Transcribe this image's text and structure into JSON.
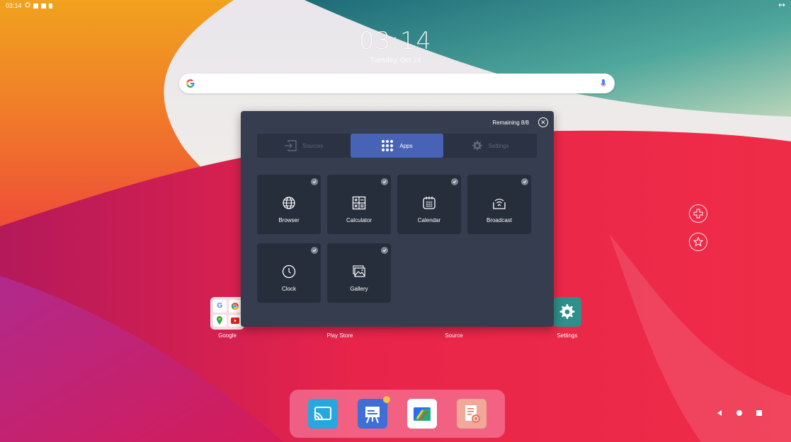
{
  "status_bar": {
    "time": "03:14"
  },
  "home": {
    "clock": "03:14",
    "date": "Tuesday, Oct 24"
  },
  "panel": {
    "remaining": "Remaining 8/8",
    "tabs": [
      {
        "label": "Sources",
        "icon": "input-icon",
        "active": false
      },
      {
        "label": "Apps",
        "icon": "grid-icon",
        "active": true
      },
      {
        "label": "Settings",
        "icon": "gear-icon",
        "active": false
      }
    ],
    "apps": [
      {
        "label": "Browser",
        "icon": "globe-icon",
        "checked": true
      },
      {
        "label": "Calculator",
        "icon": "calculator-icon",
        "checked": true
      },
      {
        "label": "Calendar",
        "icon": "calendar-icon",
        "checked": true
      },
      {
        "label": "Broadcast",
        "icon": "broadcast-icon",
        "checked": true
      },
      {
        "label": "Clock",
        "icon": "clock-icon",
        "checked": true
      },
      {
        "label": "Gallery",
        "icon": "image-icon",
        "checked": true
      }
    ]
  },
  "home_apps": [
    {
      "label": "Google"
    },
    {
      "label": "Play Store"
    },
    {
      "label": "Source"
    },
    {
      "label": "Settings"
    }
  ],
  "dock": [
    {
      "name": "cast-icon"
    },
    {
      "name": "whiteboard-icon"
    },
    {
      "name": "files-icon"
    },
    {
      "name": "notes-icon"
    }
  ],
  "colors": {
    "panel_bg": "#353d4e",
    "tab_active": "#4663b5",
    "tile_bg": "#262d3b"
  }
}
